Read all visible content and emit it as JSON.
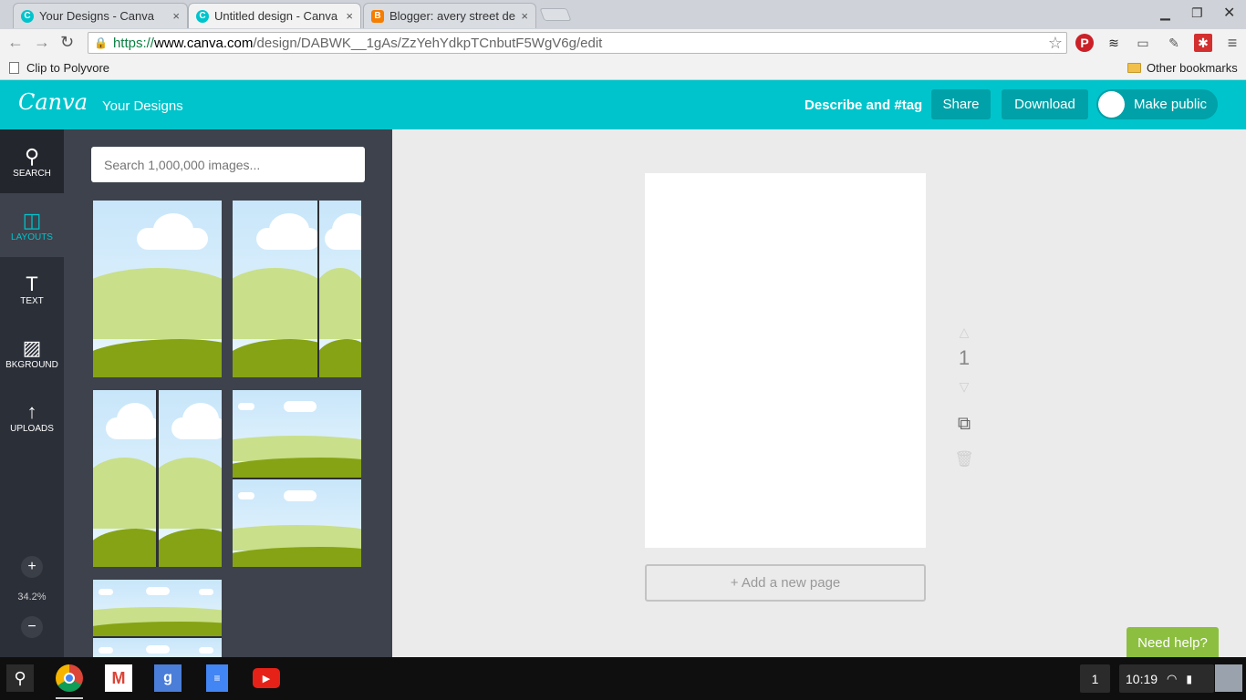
{
  "browser": {
    "tabs": [
      {
        "title": "Your Designs - Canva",
        "icon": "canva-favicon",
        "active": false
      },
      {
        "title": "Untitled design - Canva",
        "icon": "canva-favicon",
        "active": true
      },
      {
        "title": "Blogger: avery street des",
        "icon": "blogger-favicon",
        "active": false
      }
    ],
    "tab_close": "×",
    "url_scheme": "https://",
    "url_host": "www.canva.com",
    "url_path": "/design/DABWK__1gAs/ZzYehYdkpTCnbutF5WgV6g/edit",
    "bookmarks": [
      {
        "label": "Clip to Polyvore",
        "icon": "page-icon"
      },
      {
        "label": "Other bookmarks",
        "icon": "folder-icon"
      }
    ]
  },
  "canva": {
    "logo": "Canva",
    "nav_your_designs": "Your Designs",
    "describe": "Describe and #tag",
    "share": "Share",
    "download": "Download",
    "make_public": "Make public",
    "rail": [
      {
        "label": "SEARCH",
        "icon": "search-icon"
      },
      {
        "label": "LAYOUTS",
        "icon": "layouts-icon"
      },
      {
        "label": "TEXT",
        "icon": "text-icon"
      },
      {
        "label": "BKGROUND",
        "icon": "background-icon"
      },
      {
        "label": "UPLOADS",
        "icon": "upload-icon"
      }
    ],
    "zoom_level": "34.2%",
    "zoom_in": "+",
    "zoom_out": "−",
    "search_placeholder": "Search 1,000,000 images...",
    "page_number": "1",
    "add_page": "+ Add a new page",
    "need_help": "Need help?"
  },
  "shelf": {
    "notification_count": "1",
    "clock": "10:19",
    "apps": [
      "chrome-icon",
      "gmail-icon",
      "google-search-icon",
      "docs-icon",
      "youtube-icon"
    ]
  },
  "colors": {
    "canva_teal": "#00c4cc",
    "rail_bg": "#2b2f38",
    "panel_bg": "#3d424c",
    "help_green": "#8cbf3f"
  }
}
